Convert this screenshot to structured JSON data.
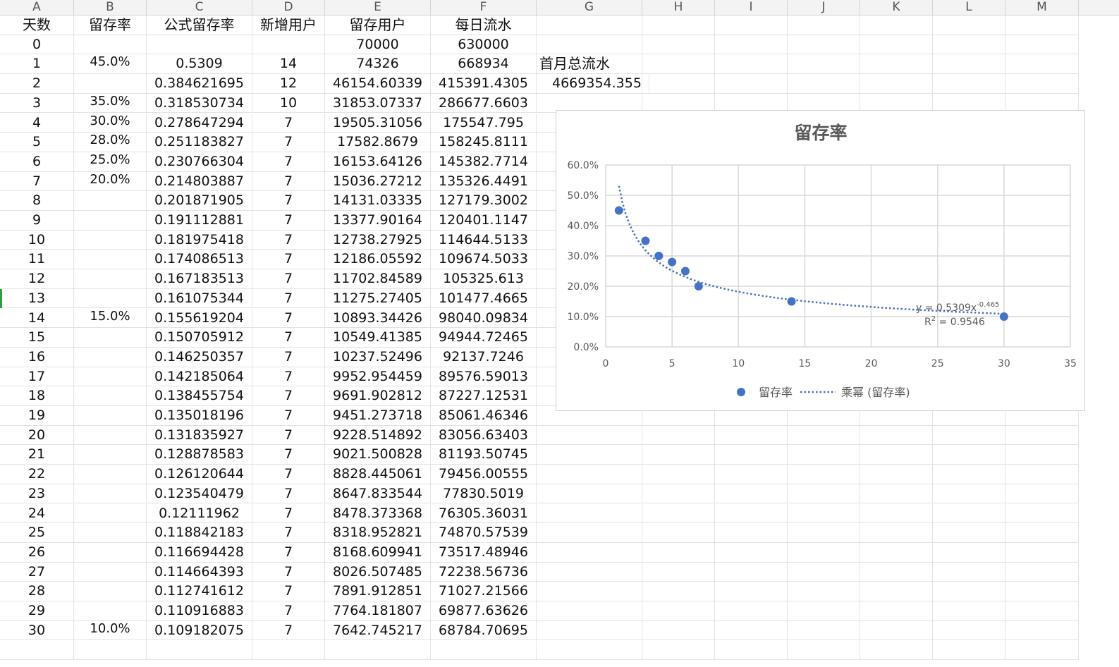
{
  "columns": [
    "A",
    "B",
    "C",
    "D",
    "E",
    "F",
    "G",
    "H",
    "I",
    "J",
    "K",
    "L",
    "M"
  ],
  "headers": [
    "天数",
    "留存率",
    "公式留存率",
    "新增用户",
    "留存用户",
    "每日流水"
  ],
  "rows": [
    [
      "0",
      "",
      "",
      "",
      "70000",
      "630000"
    ],
    [
      "1",
      "45.0%",
      "0.5309",
      "14",
      "74326",
      "668934"
    ],
    [
      "2",
      "",
      "0.384621695",
      "12",
      "46154.60339",
      "415391.4305"
    ],
    [
      "3",
      "35.0%",
      "0.318530734",
      "10",
      "31853.07337",
      "286677.6603"
    ],
    [
      "4",
      "30.0%",
      "0.278647294",
      "7",
      "19505.31056",
      "175547.795"
    ],
    [
      "5",
      "28.0%",
      "0.251183827",
      "7",
      "17582.8679",
      "158245.8111"
    ],
    [
      "6",
      "25.0%",
      "0.230766304",
      "7",
      "16153.64126",
      "145382.7714"
    ],
    [
      "7",
      "20.0%",
      "0.214803887",
      "7",
      "15036.27212",
      "135326.4491"
    ],
    [
      "8",
      "",
      "0.201871905",
      "7",
      "14131.03335",
      "127179.3002"
    ],
    [
      "9",
      "",
      "0.191112881",
      "7",
      "13377.90164",
      "120401.1147"
    ],
    [
      "10",
      "",
      "0.181975418",
      "7",
      "12738.27925",
      "114644.5133"
    ],
    [
      "11",
      "",
      "0.174086513",
      "7",
      "12186.05592",
      "109674.5033"
    ],
    [
      "12",
      "",
      "0.167183513",
      "7",
      "11702.84589",
      "105325.613"
    ],
    [
      "13",
      "",
      "0.161075344",
      "7",
      "11275.27405",
      "101477.4665"
    ],
    [
      "14",
      "15.0%",
      "0.155619204",
      "7",
      "10893.34426",
      "98040.09834"
    ],
    [
      "15",
      "",
      "0.150705912",
      "7",
      "10549.41385",
      "94944.72465"
    ],
    [
      "16",
      "",
      "0.146250357",
      "7",
      "10237.52496",
      "92137.7246"
    ],
    [
      "17",
      "",
      "0.142185064",
      "7",
      "9952.954459",
      "89576.59013"
    ],
    [
      "18",
      "",
      "0.138455754",
      "7",
      "9691.902812",
      "87227.12531"
    ],
    [
      "19",
      "",
      "0.135018196",
      "7",
      "9451.273718",
      "85061.46346"
    ],
    [
      "20",
      "",
      "0.131835927",
      "7",
      "9228.514892",
      "83056.63403"
    ],
    [
      "21",
      "",
      "0.128878583",
      "7",
      "9021.500828",
      "81193.50745"
    ],
    [
      "22",
      "",
      "0.126120644",
      "7",
      "8828.445061",
      "79456.00555"
    ],
    [
      "23",
      "",
      "0.123540479",
      "7",
      "8647.833544",
      "77830.5019"
    ],
    [
      "24",
      "",
      "0.12111962",
      "7",
      "8478.373368",
      "76305.36031"
    ],
    [
      "25",
      "",
      "0.118842183",
      "7",
      "8318.952821",
      "74870.57539"
    ],
    [
      "26",
      "",
      "0.116694428",
      "7",
      "8168.609941",
      "73517.48946"
    ],
    [
      "27",
      "",
      "0.114664393",
      "7",
      "8026.507485",
      "72238.56736"
    ],
    [
      "28",
      "",
      "0.112741612",
      "7",
      "7891.912851",
      "71027.21566"
    ],
    [
      "29",
      "",
      "0.110916883",
      "7",
      "7764.181807",
      "69877.63626"
    ],
    [
      "30",
      "10.0%",
      "0.109182075",
      "7",
      "7642.745217",
      "68784.70695"
    ]
  ],
  "side": {
    "label": "首月总流水",
    "value": "4669354.355"
  },
  "chart_data": {
    "type": "scatter",
    "title": "留存率",
    "x": [
      1,
      3,
      4,
      5,
      6,
      7,
      14,
      30
    ],
    "y": [
      0.45,
      0.35,
      0.3,
      0.28,
      0.25,
      0.2,
      0.15,
      0.1
    ],
    "xlim": [
      0,
      35
    ],
    "ylim": [
      0,
      0.6
    ],
    "x_ticks": [
      "0",
      "5",
      "10",
      "15",
      "20",
      "25",
      "30",
      "35"
    ],
    "y_ticks": [
      "0.0%",
      "10.0%",
      "20.0%",
      "30.0%",
      "40.0%",
      "50.0%",
      "60.0%"
    ],
    "grid": true,
    "trendline": {
      "type": "power",
      "a": 0.5309,
      "b": -0.465,
      "equation_prefix": "y = 0.5309x",
      "equation_exp": "-0.465",
      "r2_prefix": "R",
      "r2_sup": "2",
      "r2_value": " = 0.9546"
    },
    "legend": {
      "position": "bottom",
      "entries": [
        "留存率",
        "乘幂 (留存率)"
      ]
    },
    "colors": {
      "marker": "#4472c4",
      "trend": "#4472c4",
      "grid": "#d9d9d9",
      "text": "#595959"
    }
  }
}
